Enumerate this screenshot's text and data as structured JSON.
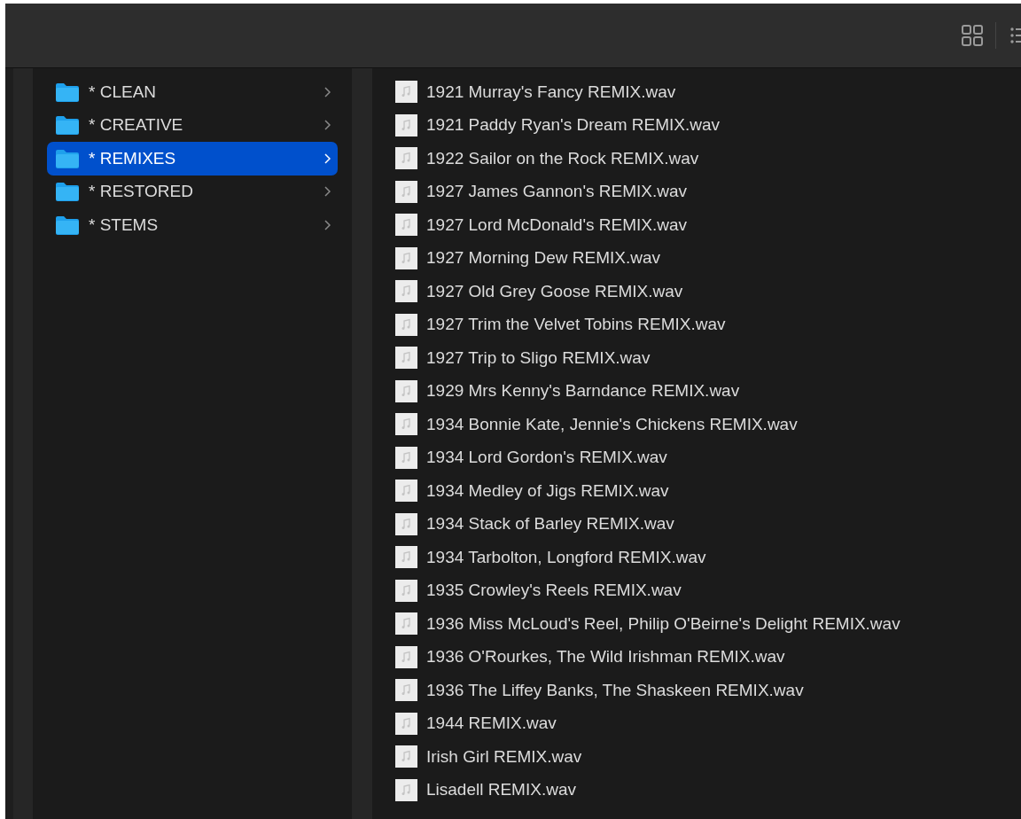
{
  "folders": [
    {
      "name": "* CLEAN",
      "selected": false
    },
    {
      "name": "* CREATIVE",
      "selected": false
    },
    {
      "name": "* REMIXES",
      "selected": true
    },
    {
      "name": "* RESTORED",
      "selected": false
    },
    {
      "name": "* STEMS",
      "selected": false
    }
  ],
  "files": [
    "1921 Murray's Fancy REMIX.wav",
    "1921 Paddy Ryan's Dream REMIX.wav",
    "1922 Sailor on the Rock REMIX.wav",
    "1927 James Gannon's REMIX.wav",
    "1927 Lord McDonald's REMIX.wav",
    "1927 Morning Dew REMIX.wav",
    "1927 Old Grey Goose REMIX.wav",
    "1927 Trim the Velvet Tobins REMIX.wav",
    "1927 Trip to Sligo REMIX.wav",
    "1929 Mrs Kenny's Barndance REMIX.wav",
    "1934 Bonnie Kate, Jennie's Chickens REMIX.wav",
    "1934 Lord Gordon's REMIX.wav",
    "1934 Medley of Jigs REMIX.wav",
    "1934 Stack of Barley REMIX.wav",
    "1934 Tarbolton, Longford REMIX.wav",
    "1935 Crowley's Reels REMIX.wav",
    "1936 Miss McLoud's Reel, Philip O'Beirne's Delight REMIX.wav",
    "1936 O'Rourkes, The Wild Irishman REMIX.wav",
    "1936 The Liffey Banks, The Shaskeen REMIX.wav",
    "1944 REMIX.wav",
    "Irish Girl REMIX.wav",
    "Lisadell REMIX.wav"
  ]
}
